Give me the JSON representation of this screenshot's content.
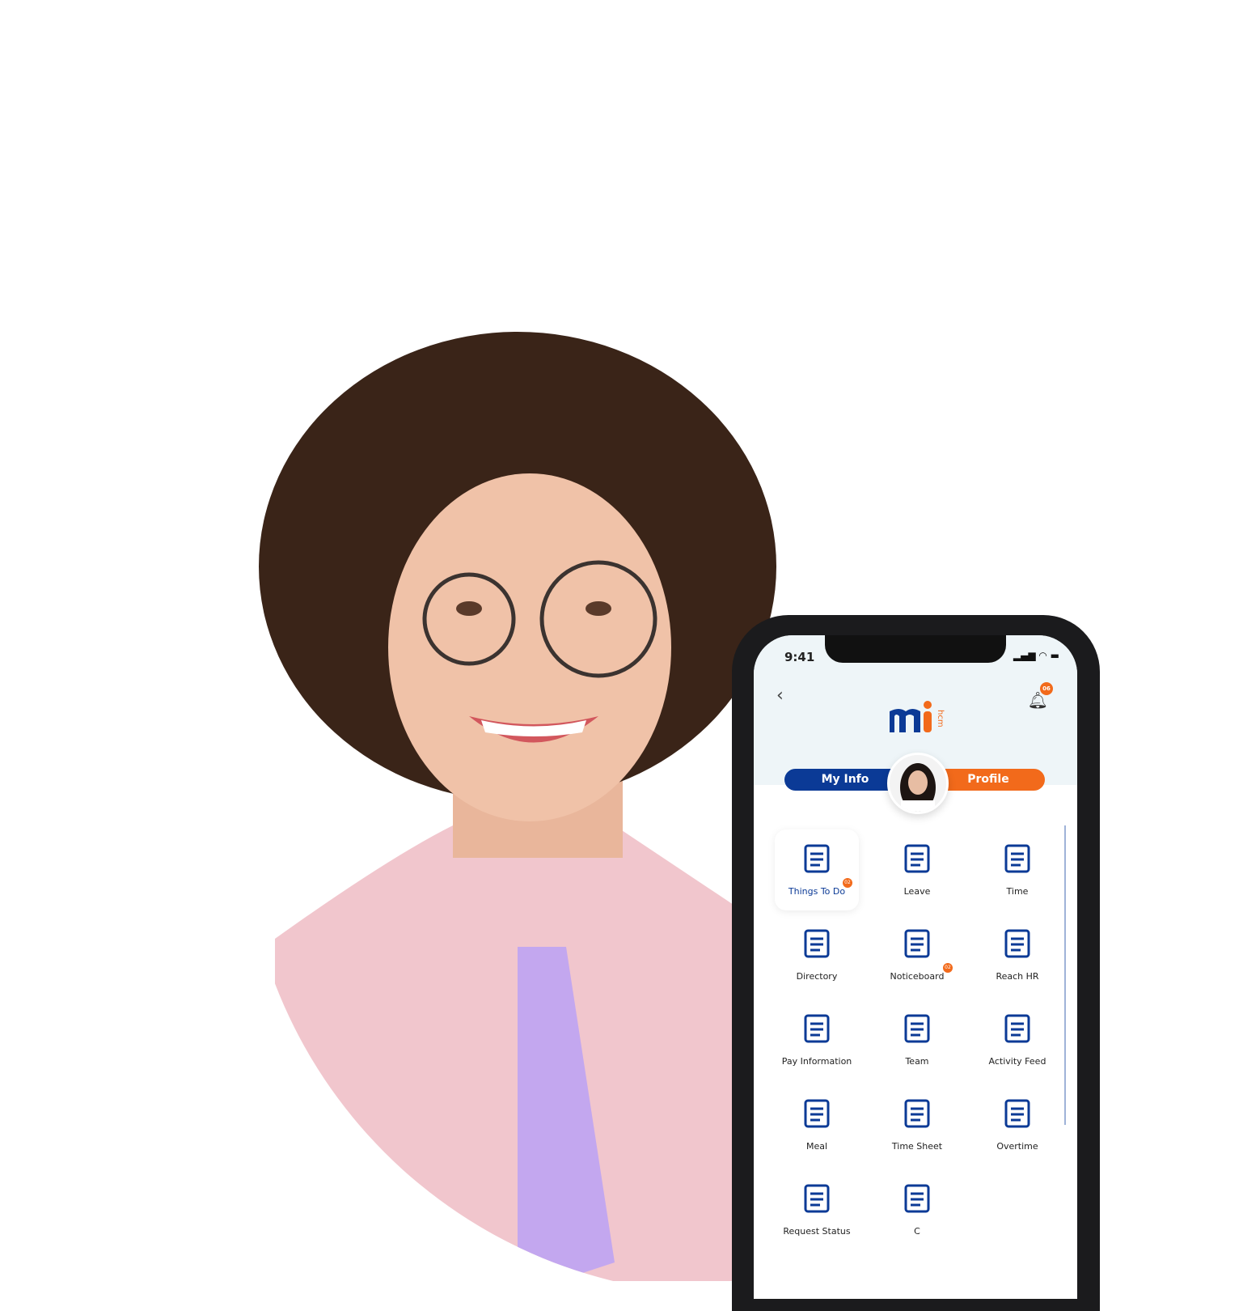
{
  "status_bar": {
    "time": "9:41"
  },
  "header": {
    "back_icon": "chevron-left-icon",
    "logo_text": "mi",
    "logo_suffix": "hcm",
    "notification_icon": "bell-icon",
    "notification_count": "06"
  },
  "tabs": {
    "my_info": "My Info",
    "profile": "Profile"
  },
  "colors": {
    "primary": "#0b3a96",
    "accent": "#f26a1b"
  },
  "menu": [
    {
      "label": "Things To Do",
      "icon": "checklist-icon",
      "badge": "02",
      "active": true
    },
    {
      "label": "Leave",
      "icon": "calendar-icon"
    },
    {
      "label": "Time",
      "icon": "stopwatch-icon"
    },
    {
      "label": "Directory",
      "icon": "notebook-icon"
    },
    {
      "label": "Noticeboard",
      "icon": "board-icon",
      "badge": "02"
    },
    {
      "label": "Reach HR",
      "icon": "chat-icon"
    },
    {
      "label": "Pay Information",
      "icon": "payslip-icon"
    },
    {
      "label": "Team",
      "icon": "team-icon"
    },
    {
      "label": "Activity Feed",
      "icon": "ruler-pencil-icon"
    },
    {
      "label": "Meal",
      "icon": "meal-icon"
    },
    {
      "label": "Time Sheet",
      "icon": "timesheet-icon"
    },
    {
      "label": "Overtime",
      "icon": "hourglass-icon"
    },
    {
      "label": "Request Status",
      "icon": "clipboard-icon"
    },
    {
      "label": "C",
      "icon": "money-hand-icon"
    }
  ]
}
